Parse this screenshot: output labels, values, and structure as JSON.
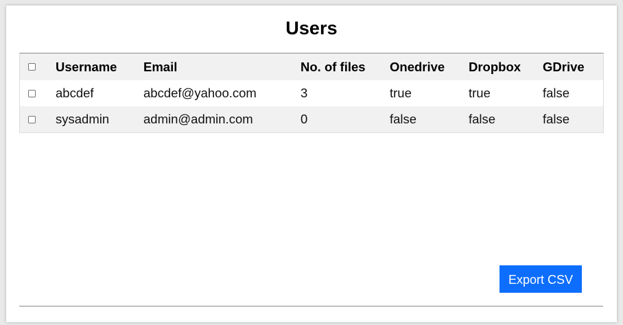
{
  "page": {
    "title": "Users"
  },
  "table": {
    "columns": [
      "Username",
      "Email",
      "No. of files",
      "Onedrive",
      "Dropbox",
      "GDrive"
    ],
    "rows": [
      {
        "username": "abcdef",
        "email": "abcdef@yahoo.com",
        "files": "3",
        "onedrive": "true",
        "dropbox": "true",
        "gdrive": "false",
        "checked": false
      },
      {
        "username": "sysadmin",
        "email": "admin@admin.com",
        "files": "0",
        "onedrive": "false",
        "dropbox": "false",
        "gdrive": "false",
        "checked": false
      }
    ],
    "select_all_checked": false
  },
  "actions": {
    "export_label": "Export CSV"
  },
  "colors": {
    "accent": "#0d6efd",
    "row_stripe": "#f1f1f1",
    "background": "#ffffff"
  }
}
